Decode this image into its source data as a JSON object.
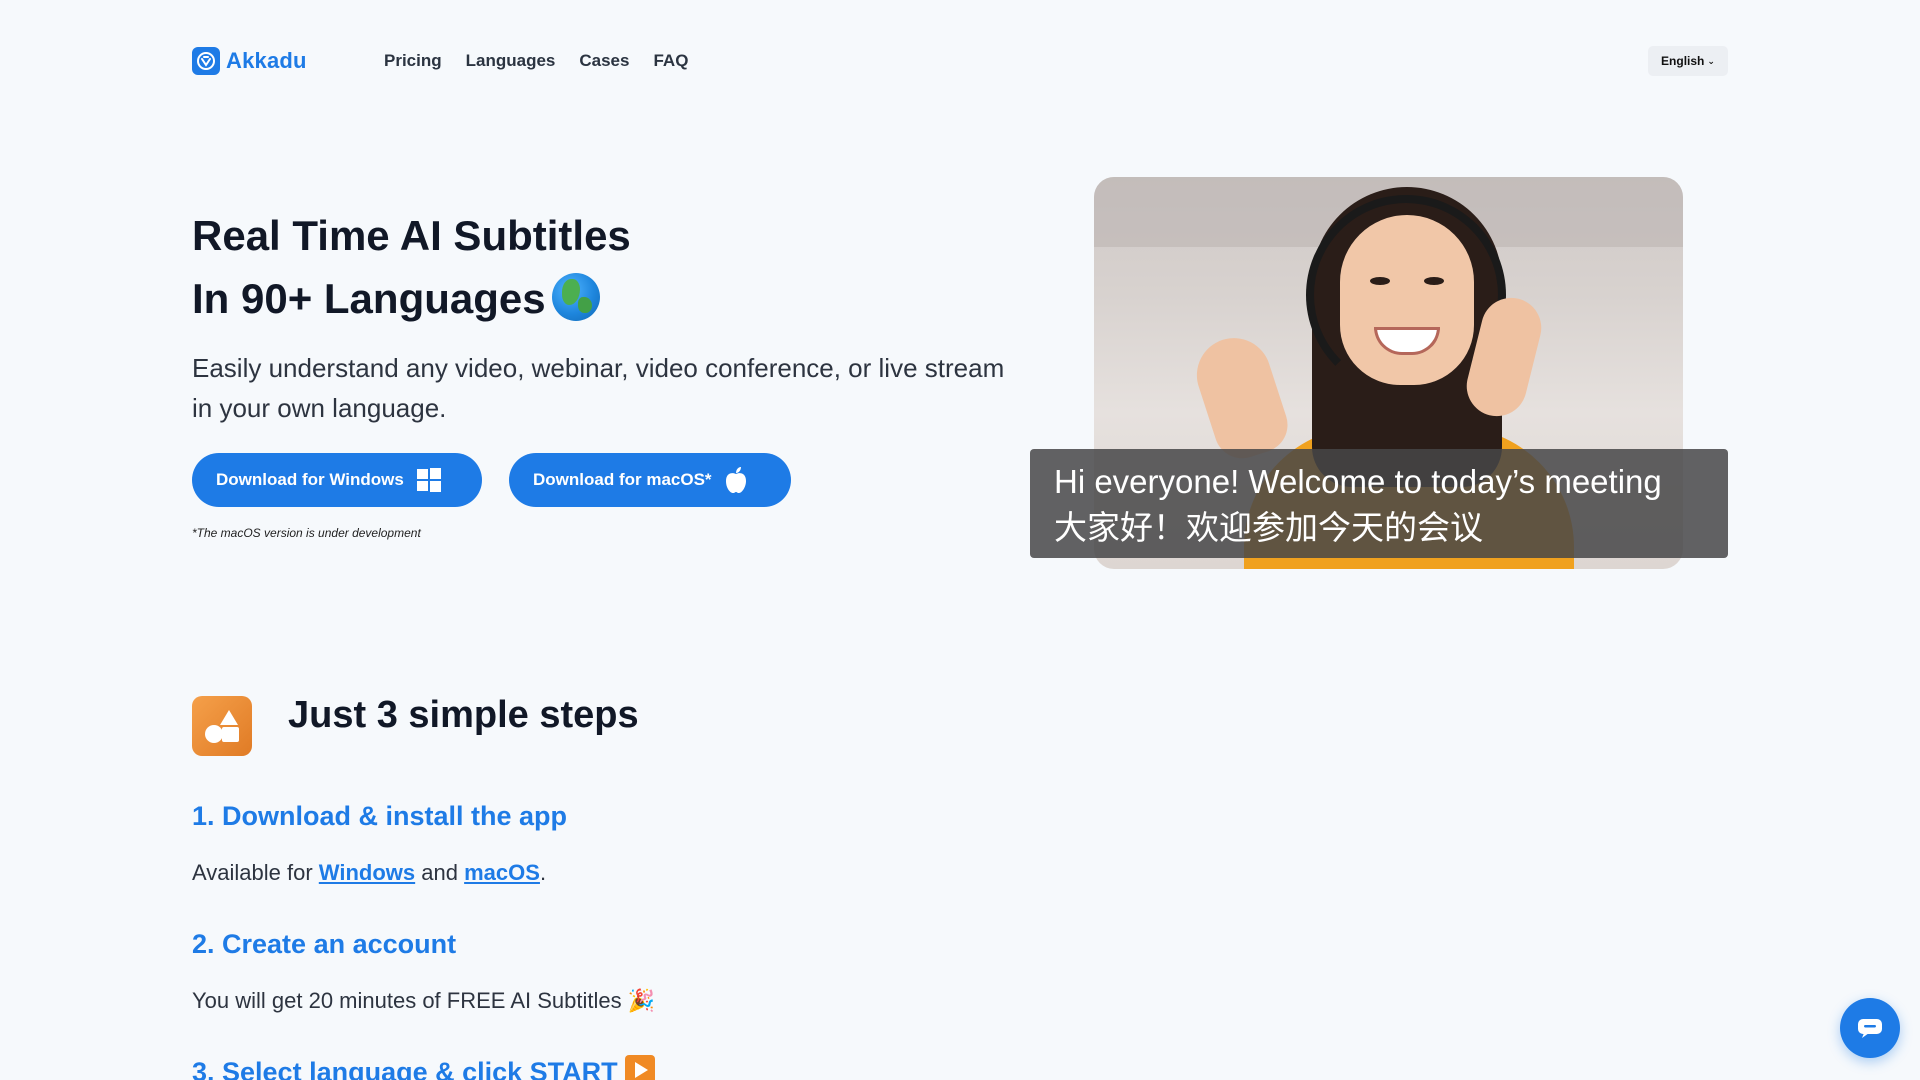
{
  "header": {
    "logo_text": "Akkadu",
    "nav": [
      "Pricing",
      "Languages",
      "Cases",
      "FAQ"
    ],
    "language_selected": "English"
  },
  "hero": {
    "title_line1": "Real Time AI Subtitles",
    "title_line2": "In 90+ Languages",
    "subtitle": "Easily understand any video, webinar, video conference, or live stream in your own language.",
    "btn_windows": "Download for Windows",
    "btn_mac": "Download for macOS*",
    "note": "*The macOS version is under development",
    "caption_en": "Hi everyone! Welcome to today’s meeting",
    "caption_zh": "大家好！欢迎参加今天的会议"
  },
  "steps": {
    "title": "Just 3 simple steps",
    "step1_title": "1. Download & install the app",
    "step1_prefix": "Available for",
    "step1_link_windows": "Windows",
    "step1_and": "and",
    "step1_link_mac": "macOS",
    "step1_suffix": ".",
    "step2_title": "2. Create an account",
    "step2_text": "You will get 20 minutes of FREE AI Subtitles 🎉",
    "step3_title": "3. Select language & click START"
  },
  "colors": {
    "accent": "#1e7be6",
    "background": "#f6f9fc",
    "steps_icon": "#e07b25"
  }
}
